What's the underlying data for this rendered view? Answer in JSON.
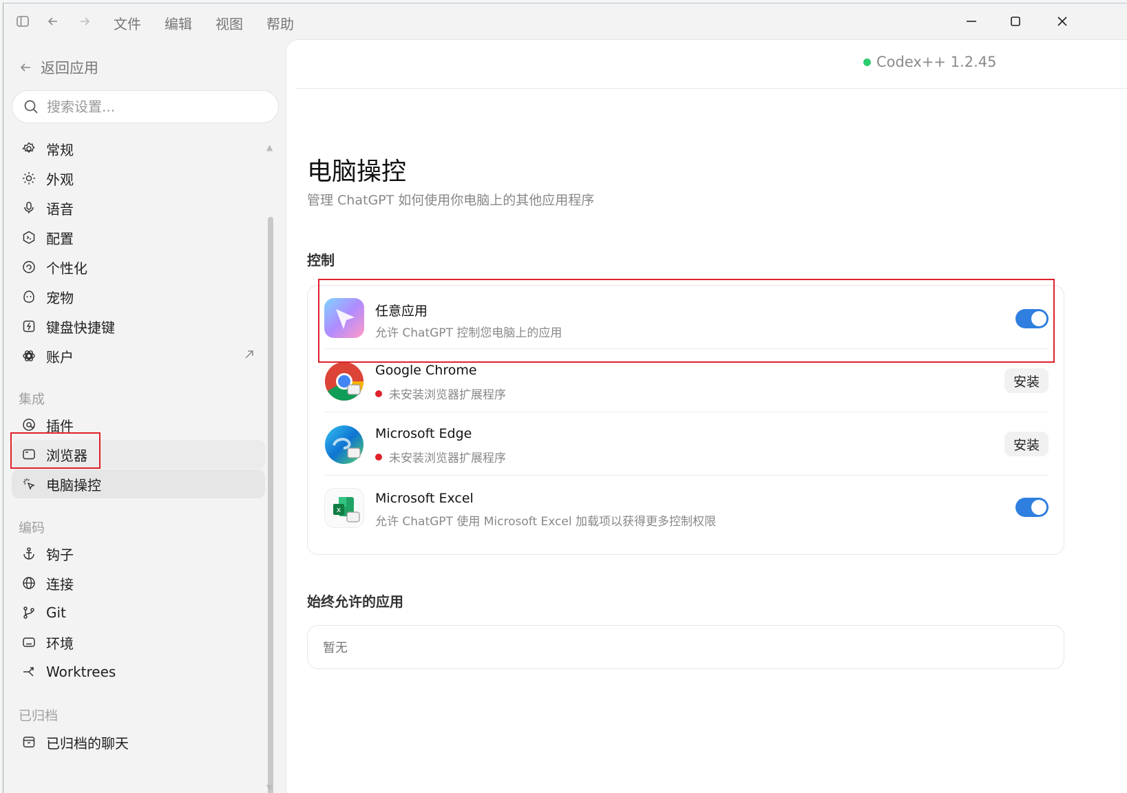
{
  "menu": {
    "file": "文件",
    "edit": "编辑",
    "view": "视图",
    "help": "帮助"
  },
  "sidebar": {
    "back_label": "返回应用",
    "search_placeholder": "搜索设置...",
    "items_general": [
      {
        "label": "常规",
        "icon": "gear-icon"
      },
      {
        "label": "外观",
        "icon": "sun-icon"
      },
      {
        "label": "语音",
        "icon": "microphone-icon"
      },
      {
        "label": "配置",
        "icon": "config-icon"
      },
      {
        "label": "个性化",
        "icon": "personalize-icon"
      },
      {
        "label": "宠物",
        "icon": "pet-icon"
      },
      {
        "label": "键盘快捷键",
        "icon": "keyboard-icon"
      },
      {
        "label": "账户",
        "icon": "openai-icon"
      }
    ],
    "section_integration": "集成",
    "items_integration": [
      {
        "label": "插件",
        "icon": "plugin-icon"
      },
      {
        "label": "浏览器",
        "icon": "browser-icon"
      },
      {
        "label": "电脑操控",
        "icon": "computer-control-icon"
      }
    ],
    "section_coding": "编码",
    "items_coding": [
      {
        "label": "钩子",
        "icon": "anchor-icon"
      },
      {
        "label": "连接",
        "icon": "globe-icon"
      },
      {
        "label": "Git",
        "icon": "git-branch-icon"
      },
      {
        "label": "环境",
        "icon": "environment-icon"
      },
      {
        "label": "Worktrees",
        "icon": "worktree-icon"
      }
    ],
    "section_archived": "已归档",
    "items_archived": [
      {
        "label": "已归档的聊天",
        "icon": "archive-icon"
      }
    ]
  },
  "header": {
    "version": "Codex++ 1.2.45",
    "status_color": "#2ecc71"
  },
  "page": {
    "title": "电脑操控",
    "subtitle": "管理 ChatGPT 如何使用你电脑上的其他应用程序",
    "control_heading": "控制",
    "apps": [
      {
        "name": "任意应用",
        "desc": "允许 ChatGPT 控制您电脑上的应用",
        "control": "toggle",
        "enabled": true
      },
      {
        "name": "Google Chrome",
        "desc": "未安装浏览器扩展程序",
        "control": "button",
        "button_label": "安装"
      },
      {
        "name": "Microsoft Edge",
        "desc": "未安装浏览器扩展程序",
        "control": "button",
        "button_label": "安装"
      },
      {
        "name": "Microsoft Excel",
        "desc": "允许 ChatGPT 使用 Microsoft Excel 加载项以获得更多控制权限",
        "control": "toggle",
        "enabled": true
      }
    ],
    "always_allowed_heading": "始终允许的应用",
    "always_allowed_empty": "暂无"
  },
  "colors": {
    "toggle_on": "#2f7fe0",
    "highlight_box": "#e0202a",
    "error_dot": "#e0202a"
  }
}
